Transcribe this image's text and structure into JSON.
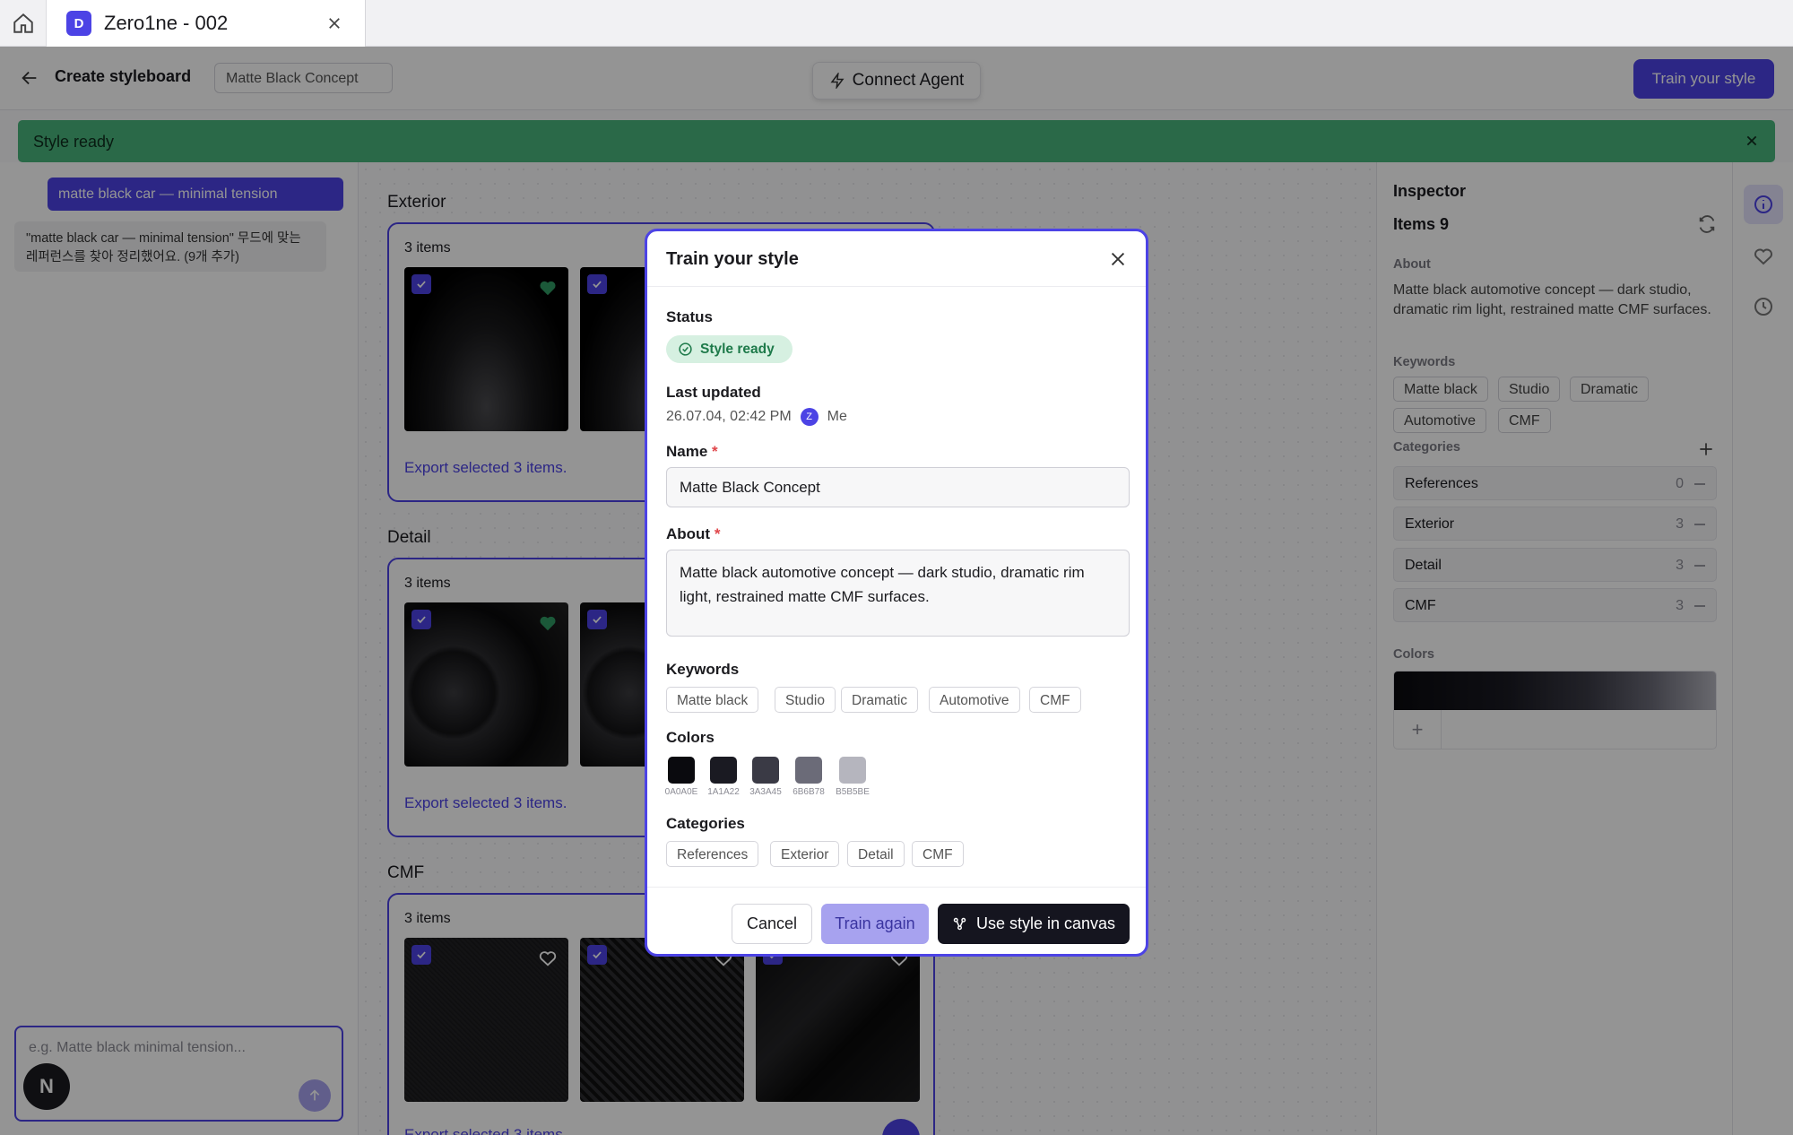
{
  "tab": {
    "badge": "D",
    "title": "Zero1ne - 002"
  },
  "header": {
    "title": "Create styleboard",
    "name_chip": "Matte Black Concept",
    "connect_label": "Connect Agent",
    "train_label": "Train your style"
  },
  "banner": {
    "text": "Style ready"
  },
  "chat": {
    "user_message": "matte black car — minimal tension",
    "reply": "\"matte black car — minimal tension\" 무드에 맞는 레퍼런스를 찾아 정리했어요. (9개 추가)",
    "placeholder": "e.g. Matte black minimal tension...",
    "avatar_letter": "N"
  },
  "sections": [
    {
      "title": "Exterior",
      "count": "3 items",
      "export": "Export selected 3 items."
    },
    {
      "title": "Detail",
      "count": "3 items",
      "export": "Export selected 3 items."
    },
    {
      "title": "CMF",
      "count": "3 items",
      "export": "Export selected 3 items."
    }
  ],
  "inspector": {
    "title": "Inspector",
    "items": "Items 9",
    "about_label": "About",
    "about": "Matte black automotive concept — dark studio, dramatic rim light, restrained matte CMF surfaces.",
    "keywords_label": "Keywords",
    "keywords": [
      "Matte black",
      "Studio",
      "Dramatic",
      "Automotive",
      "CMF"
    ],
    "categories_label": "Categories",
    "categories": [
      {
        "name": "References",
        "count": "0"
      },
      {
        "name": "Exterior",
        "count": "3"
      },
      {
        "name": "Detail",
        "count": "3"
      },
      {
        "name": "CMF",
        "count": "3"
      }
    ],
    "colors_label": "Colors",
    "add_color": "+"
  },
  "modal": {
    "title": "Train your style",
    "status_label": "Status",
    "status": "Style ready",
    "updated_label": "Last updated",
    "updated_value": "26.07.04, 02:42 PM",
    "updated_by_initial": "Z",
    "updated_by": "Me",
    "name_label": "Name",
    "name_value": "Matte Black Concept",
    "about_label": "About",
    "about_value": "Matte black automotive concept — dark studio, dramatic rim light, restrained matte CMF surfaces.",
    "keywords_label": "Keywords",
    "keywords": [
      "Matte black",
      "Studio",
      "Dramatic",
      "Automotive",
      "CMF"
    ],
    "colors_label": "Colors",
    "colors": [
      {
        "hex": "#0A0A0E",
        "label": "0A0A0E"
      },
      {
        "hex": "#1A1A22",
        "label": "1A1A22"
      },
      {
        "hex": "#3A3A45",
        "label": "3A3A45"
      },
      {
        "hex": "#6B6B78",
        "label": "6B6B78"
      },
      {
        "hex": "#B5B5BE",
        "label": "B5B5BE"
      }
    ],
    "categories_label": "Categories",
    "categories": [
      "References",
      "Exterior",
      "Detail",
      "CMF"
    ],
    "cancel": "Cancel",
    "train_again": "Train again",
    "use_in_canvas": "Use style in canvas",
    "required_mark": "*"
  },
  "theme": {
    "accent": "#4c43e5",
    "success": "#49b57c"
  }
}
